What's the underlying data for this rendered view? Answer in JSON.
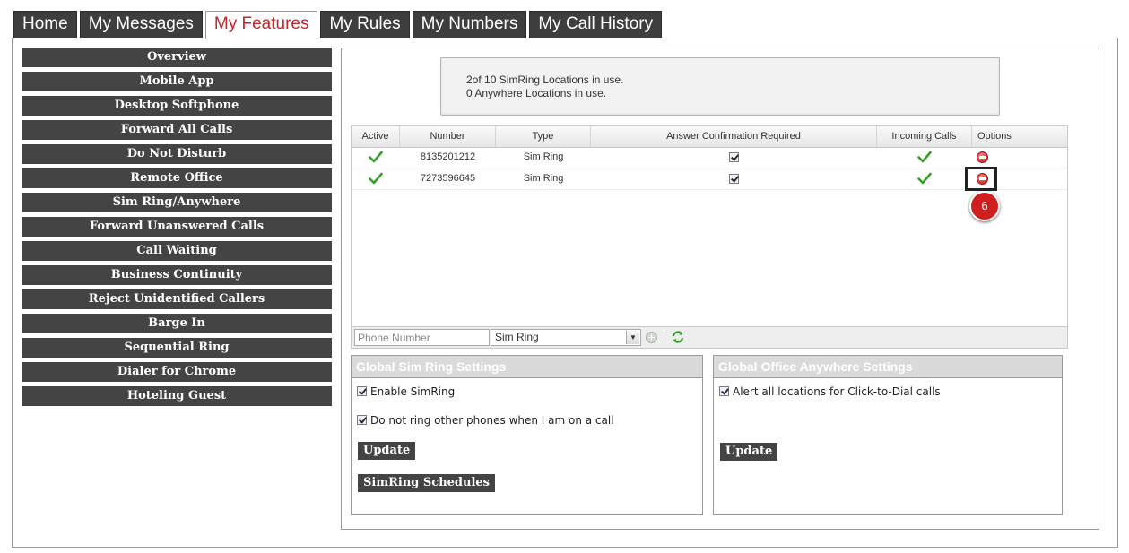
{
  "tabs": [
    {
      "label": "Home",
      "active": false
    },
    {
      "label": "My Messages",
      "active": false
    },
    {
      "label": "My Features",
      "active": true
    },
    {
      "label": "My Rules",
      "active": false
    },
    {
      "label": "My Numbers",
      "active": false
    },
    {
      "label": "My Call History",
      "active": false
    }
  ],
  "sidebar": {
    "items": [
      "Overview",
      "Mobile App",
      "Desktop Softphone",
      "Forward All Calls",
      "Do Not Disturb",
      "Remote Office",
      "Sim Ring/Anywhere",
      "Forward Unanswered Calls",
      "Call Waiting",
      "Business Continuity",
      "Reject Unidentified Callers",
      "Barge In",
      "Sequential Ring",
      "Dialer for Chrome",
      "Hoteling Guest"
    ]
  },
  "usage": {
    "line1": "2of 10 SimRing Locations in use.",
    "line2": "0 Anywhere Locations in use."
  },
  "grid": {
    "columns": [
      "Active",
      "Number",
      "Type",
      "Answer Confirmation Required",
      "Incoming Calls",
      "Options"
    ],
    "rows": [
      {
        "active": true,
        "number": "8135201212",
        "type": "Sim Ring",
        "answer_confirmation": true,
        "incoming_calls": true
      },
      {
        "active": true,
        "number": "7273596645",
        "type": "Sim Ring",
        "answer_confirmation": true,
        "incoming_calls": true
      }
    ],
    "footer": {
      "phone_placeholder": "Phone Number",
      "type_selected": "Sim Ring"
    }
  },
  "callout": {
    "step": "6"
  },
  "global_simring": {
    "title": "Global Sim Ring Settings",
    "enable_label": "Enable SimRing",
    "enable_checked": true,
    "no_ring_label": "Do not ring other phones when I am on a call",
    "no_ring_checked": true,
    "update_label": "Update",
    "schedules_label": "SimRing Schedules"
  },
  "global_anywhere": {
    "title": "Global Office Anywhere Settings",
    "alert_label": "Alert all locations for Click-to-Dial calls",
    "alert_checked": true,
    "update_label": "Update"
  },
  "colors": {
    "active_tab_text": "#c0282d",
    "nav_bg": "#444444",
    "check_green": "#3a9c2e",
    "remove_red": "#d32f2f"
  }
}
